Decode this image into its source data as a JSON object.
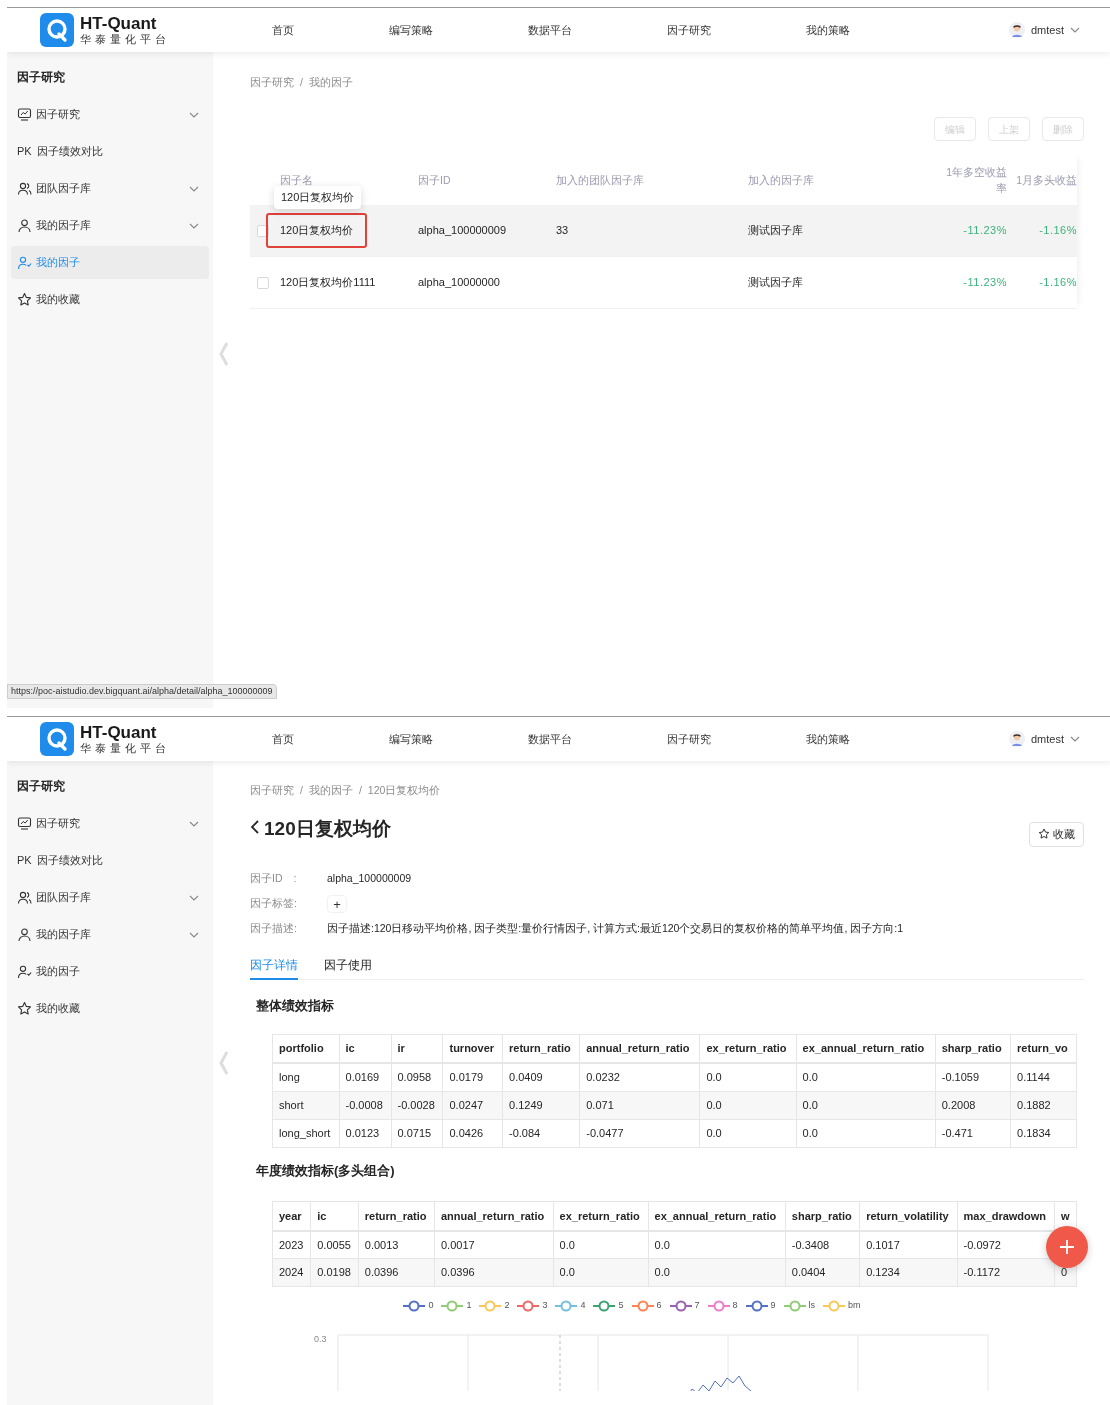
{
  "screens": [
    {
      "header": {
        "logo_title": "HT-Quant",
        "logo_subtitle": "华泰量化平台",
        "nav": [
          "首页",
          "编写策略",
          "数据平台",
          "因子研究",
          "我的策略"
        ],
        "user": "dmtest"
      },
      "sidebar": {
        "title": "因子研究",
        "items": [
          {
            "kind": "monitor",
            "label": "因子研究",
            "expandable": true,
            "selected": false
          },
          {
            "kind": "badge",
            "badge": "PK",
            "label": "因子绩效对比",
            "expandable": false,
            "selected": false
          },
          {
            "kind": "users",
            "label": "团队因子库",
            "expandable": true,
            "selected": false
          },
          {
            "kind": "user",
            "label": "我的因子库",
            "expandable": true,
            "selected": false
          },
          {
            "kind": "user-check",
            "label": "我的因子",
            "expandable": false,
            "selected": true
          },
          {
            "kind": "star",
            "label": "我的收藏",
            "expandable": false,
            "selected": false
          }
        ]
      },
      "content": {
        "kind": "factor_list",
        "breadcrumb": [
          "因子研究",
          "我的因子"
        ],
        "breadcrumb_separator": "/",
        "actions": [
          {
            "label": "编辑",
            "disabled": true
          },
          {
            "label": "上架",
            "disabled": true
          },
          {
            "label": "删除",
            "disabled": true
          }
        ],
        "columns": [
          "因子名",
          "因子ID",
          "加入的团队因子库",
          "加入的因子库",
          "1年多空收益率",
          "1月多头收益"
        ],
        "rows": [
          {
            "checked": false,
            "hovered": true,
            "outlined": true,
            "tooltip": "120日复权均价",
            "cells": [
              "120日复权均价",
              "alpha_100000009",
              "33",
              "测试因子库",
              "-11.23%",
              "-1.16%"
            ]
          },
          {
            "checked": false,
            "hovered": false,
            "outlined": false,
            "cells": [
              "120日复权均价1111",
              "alpha_10000000",
              "",
              "测试因子库",
              "-11.23%",
              "-1.16%"
            ]
          }
        ]
      },
      "status_url": "https://poc-aistudio.dev.bigquant.ai/alpha/detail/alpha_100000009"
    },
    {
      "header": {
        "logo_title": "HT-Quant",
        "logo_subtitle": "华泰量化平台",
        "nav": [
          "首页",
          "编写策略",
          "数据平台",
          "因子研究",
          "我的策略"
        ],
        "user": "dmtest"
      },
      "sidebar": {
        "title": "因子研究",
        "items": [
          {
            "kind": "monitor",
            "label": "因子研究",
            "expandable": true,
            "selected": false
          },
          {
            "kind": "badge",
            "badge": "PK",
            "label": "因子绩效对比",
            "expandable": false,
            "selected": false
          },
          {
            "kind": "users",
            "label": "团队因子库",
            "expandable": true,
            "selected": false
          },
          {
            "kind": "user",
            "label": "我的因子库",
            "expandable": true,
            "selected": false
          },
          {
            "kind": "user-check",
            "label": "我的因子",
            "expandable": false,
            "selected": false
          },
          {
            "kind": "star",
            "label": "我的收藏",
            "expandable": false,
            "selected": false
          }
        ]
      },
      "content": {
        "kind": "factor_detail",
        "breadcrumb": [
          "因子研究",
          "我的因子",
          "120日复权均价"
        ],
        "breadcrumb_separator": "/",
        "title": "120日复权均价",
        "favorite_label": "收藏",
        "fields": [
          {
            "kind": "text",
            "label": "因子ID　:",
            "value": "alpha_100000009"
          },
          {
            "kind": "add",
            "label": "因子标签:",
            "value": "+"
          },
          {
            "kind": "text",
            "label": "因子描述:",
            "value": "因子描述:120日移动平均价格, 因子类型:量价行情因子, 计算方式:最近120个交易日的复权价格的简单平均值, 因子方向:1"
          }
        ],
        "tabs": [
          {
            "label": "因子详情",
            "selected": true
          },
          {
            "label": "因子使用",
            "selected": false
          }
        ],
        "sections": [
          {
            "title": "整体绩效指标",
            "columns": [
              "portfolio",
              "ic",
              "ir",
              "turnover",
              "return_ratio",
              "annual_return_ratio",
              "ex_return_ratio",
              "ex_annual_return_ratio",
              "sharp_ratio",
              "return_vo"
            ],
            "rows": [
              [
                "long",
                "0.0169",
                "0.0958",
                "0.0179",
                "0.0409",
                "0.0232",
                "0.0",
                "0.0",
                "-0.1059",
                "0.1144"
              ],
              [
                "short",
                "-0.0008",
                "-0.0028",
                "0.0247",
                "0.1249",
                "0.071",
                "0.0",
                "0.0",
                "0.2008",
                "0.1882"
              ],
              [
                "long_short",
                "0.0123",
                "0.0715",
                "0.0426",
                "-0.084",
                "-0.0477",
                "0.0",
                "0.0",
                "-0.471",
                "0.1834"
              ]
            ]
          },
          {
            "title": "年度绩效指标(多头组合)",
            "columns": [
              "year",
              "ic",
              "return_ratio",
              "annual_return_ratio",
              "ex_return_ratio",
              "ex_annual_return_ratio",
              "sharp_ratio",
              "return_volatility",
              "max_drawdown",
              "w"
            ],
            "rows": [
              [
                "2023",
                "0.0055",
                "0.0013",
                "0.0017",
                "0.0",
                "0.0",
                "-0.3408",
                "0.1017",
                "-0.0972"
              ],
              [
                "2024",
                "0.0198",
                "0.0396",
                "0.0396",
                "0.0",
                "0.0",
                "0.0404",
                "0.1234",
                "-0.1172",
                "0"
              ]
            ]
          }
        ],
        "chart": {
          "legend": [
            {
              "label": "0",
              "color": "#5470c6"
            },
            {
              "label": "1",
              "color": "#91cc75"
            },
            {
              "label": "2",
              "color": "#fac858"
            },
            {
              "label": "3",
              "color": "#ee6666"
            },
            {
              "label": "4",
              "color": "#73c0de"
            },
            {
              "label": "5",
              "color": "#3ba272"
            },
            {
              "label": "6",
              "color": "#fc8452"
            },
            {
              "label": "7",
              "color": "#9a60b4"
            },
            {
              "label": "8",
              "color": "#ea7ccc"
            },
            {
              "label": "9",
              "color": "#5470c6"
            },
            {
              "label": "ls",
              "color": "#91cc75"
            },
            {
              "label": "bm",
              "color": "#fac858"
            }
          ],
          "y_tick_label": "0.3"
        }
      }
    }
  ]
}
